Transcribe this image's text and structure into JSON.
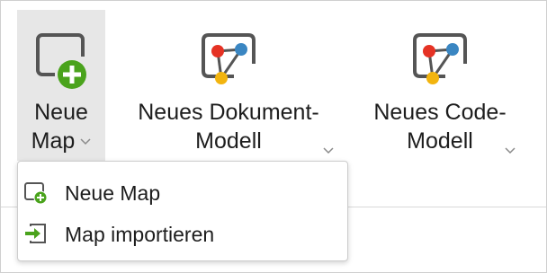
{
  "ribbon": {
    "buttons": [
      {
        "line1": "Neue",
        "line2": "Map",
        "icon": "new-map-icon",
        "has_dropdown": true,
        "active": true
      },
      {
        "line1": "Neues Dokument-",
        "line2": "Modell",
        "icon": "graph-model-icon",
        "has_dropdown": true
      },
      {
        "line1": "Neues Code-",
        "line2": "Modell",
        "icon": "graph-model-icon",
        "has_dropdown": true
      }
    ]
  },
  "menu": {
    "items": [
      {
        "label": "Neue Map",
        "icon": "new-map-small-icon"
      },
      {
        "label": "Map importieren",
        "icon": "import-map-icon"
      }
    ]
  },
  "colors": {
    "icon_frame": "#555555",
    "green": "#4aa31c",
    "node_red": "#e53224",
    "node_blue": "#3a86c2",
    "node_yellow": "#f2b40f",
    "active_bg": "#e7e7e7"
  }
}
